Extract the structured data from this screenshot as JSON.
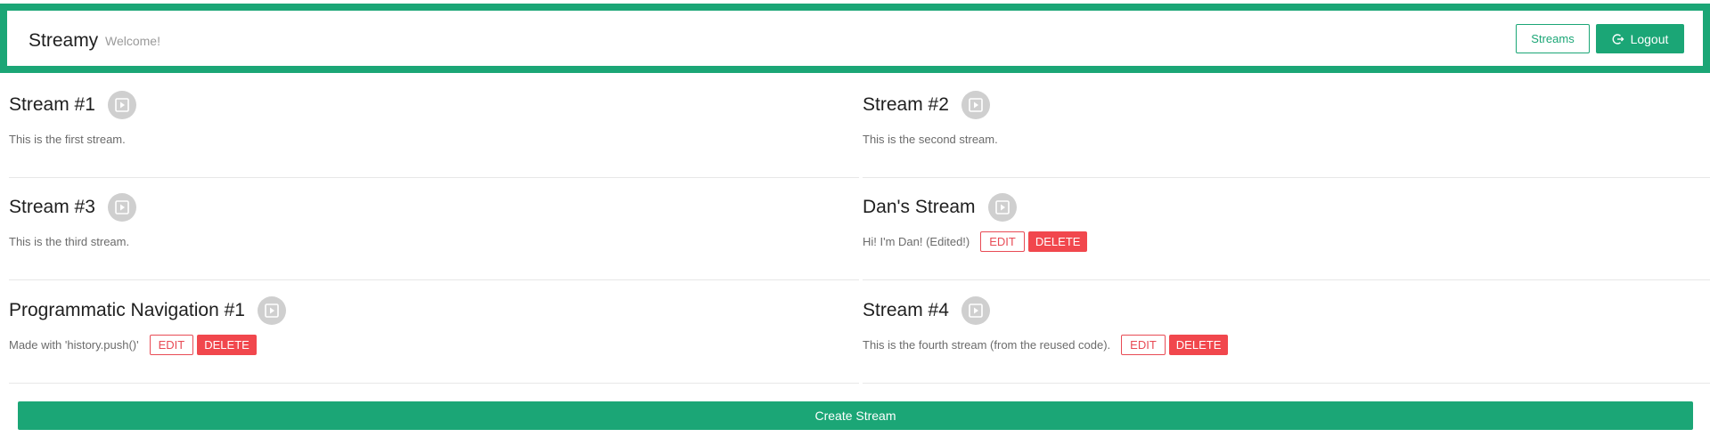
{
  "header": {
    "brand": "Streamy",
    "welcome": "Welcome!",
    "streams_button": "Streams",
    "logout_button": "Logout"
  },
  "streams": [
    {
      "title": "Stream #1",
      "description": "This is the first stream."
    },
    {
      "title": "Stream #2",
      "description": "This is the second stream."
    },
    {
      "title": "Stream #3",
      "description": "This is the third stream."
    },
    {
      "title": "Dan's Stream",
      "description": "Hi! I'm Dan! (Edited!)"
    },
    {
      "title": "Programmatic Navigation #1",
      "description": "Made with 'history.push()'"
    },
    {
      "title": "Stream #4",
      "description": "This is the fourth stream (from the reused code)."
    }
  ],
  "actions": {
    "edit_label": "EDIT",
    "delete_label": "DELETE",
    "create_label": "Create Stream"
  },
  "colors": {
    "primary": "#1ba676",
    "danger": "#f1474d",
    "play_icon_bg": "#cfcfcf"
  },
  "icons": {
    "play": "play-icon",
    "logout": "logout-icon"
  }
}
